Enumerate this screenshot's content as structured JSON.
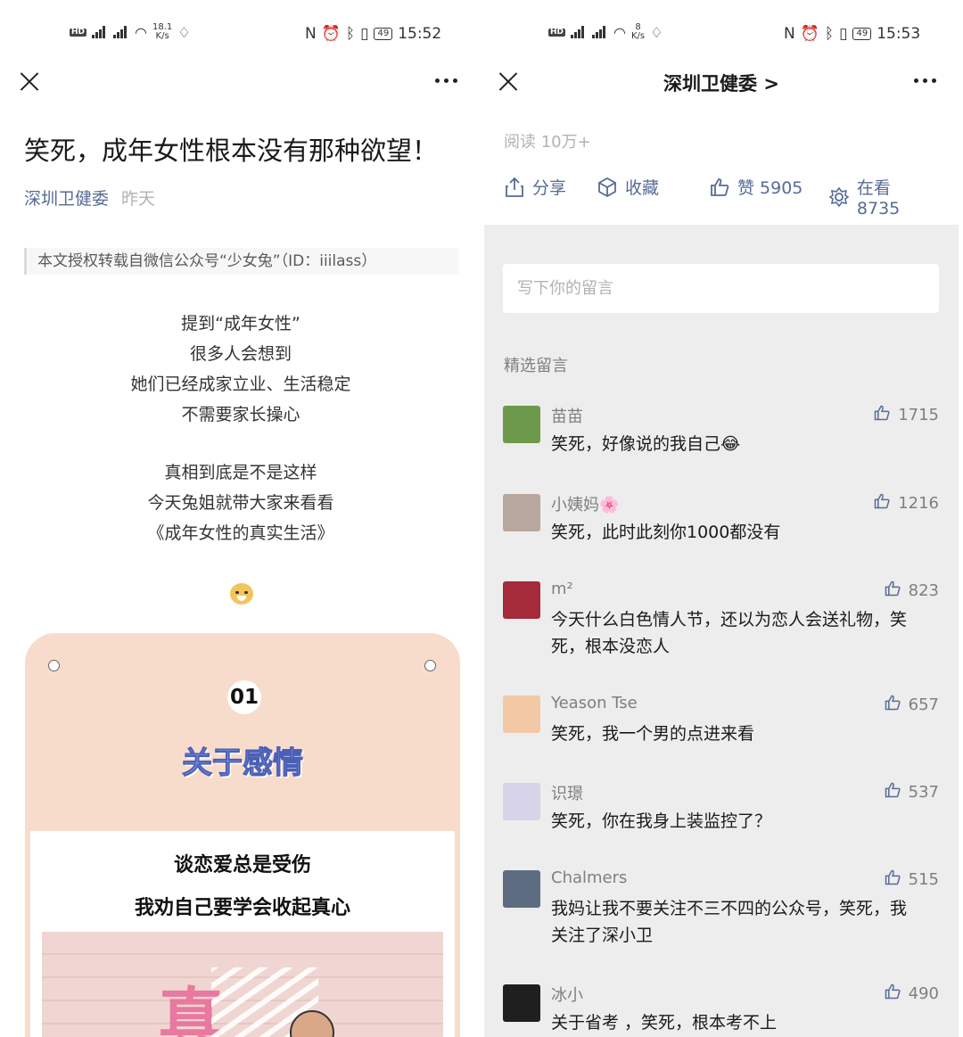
{
  "left": {
    "status": {
      "speed_value": "18.1",
      "speed_unit": "K/s",
      "battery": "49",
      "time": "15:52"
    },
    "article": {
      "title": "笑死，成年女性根本没有那种欲望！",
      "source": "深圳卫健委",
      "date": "昨天",
      "quote": "本文授权转载自微信公众号“少女兔”（ID：iiilass）",
      "para1": [
        "提到“成年女性”",
        "很多人会想到",
        "她们已经成家立业、生活稳定",
        "不需要家长操心"
      ],
      "para2": [
        "真相到底是不是这样",
        "今天兔姐就带大家来看看",
        "《成年女性的真实生活》"
      ],
      "emoji": "dog-emoji"
    },
    "card": {
      "number": "01",
      "title": "关于感情",
      "line1": "谈恋爱总是受伤",
      "line2": "我劝自己要学会收起真心",
      "photo_text": "真"
    }
  },
  "right": {
    "status": {
      "speed_value": "8",
      "speed_unit": "K/s",
      "battery": "49",
      "time": "15:53"
    },
    "nav_title": "深圳卫健委 >",
    "reads": "阅读 10万+",
    "actions": {
      "share": "分享",
      "collect": "收藏",
      "like": "赞 5905",
      "watching": "在看 8735"
    },
    "input_placeholder": "写下你的留言",
    "selected_label": "精选留言",
    "comments": [
      {
        "name": "苗苗",
        "likes": "1715",
        "text": "笑死，好像说的我自己😂",
        "avatar": "#6d9a4a"
      },
      {
        "name": "小姨妈🌸",
        "likes": "1216",
        "text": "笑死，此时此刻你1000都没有",
        "avatar": "#b8a79c"
      },
      {
        "name": "m²",
        "likes": "823",
        "text": "今天什么白色情人节，还以为恋人会送礼物，笑死，根本没恋人",
        "avatar": "#a52a3a"
      },
      {
        "name": "Yeason Tse",
        "likes": "657",
        "text": "笑死，我一个男的点进来看",
        "avatar": "#f3c9a5"
      },
      {
        "name": "识璟",
        "likes": "537",
        "text": "笑死，你在我身上装监控了？",
        "avatar": "#d7d3e8"
      },
      {
        "name": "Chalmers",
        "likes": "515",
        "text": "我妈让我不要关注不三不四的公众号，笑死，我关注了深小卫",
        "avatar": "#5d6c80"
      },
      {
        "name": "冰小",
        "likes": "490",
        "text": "关于省考 ，笑死，根本考不上",
        "avatar": "#1f1f1f"
      }
    ]
  }
}
